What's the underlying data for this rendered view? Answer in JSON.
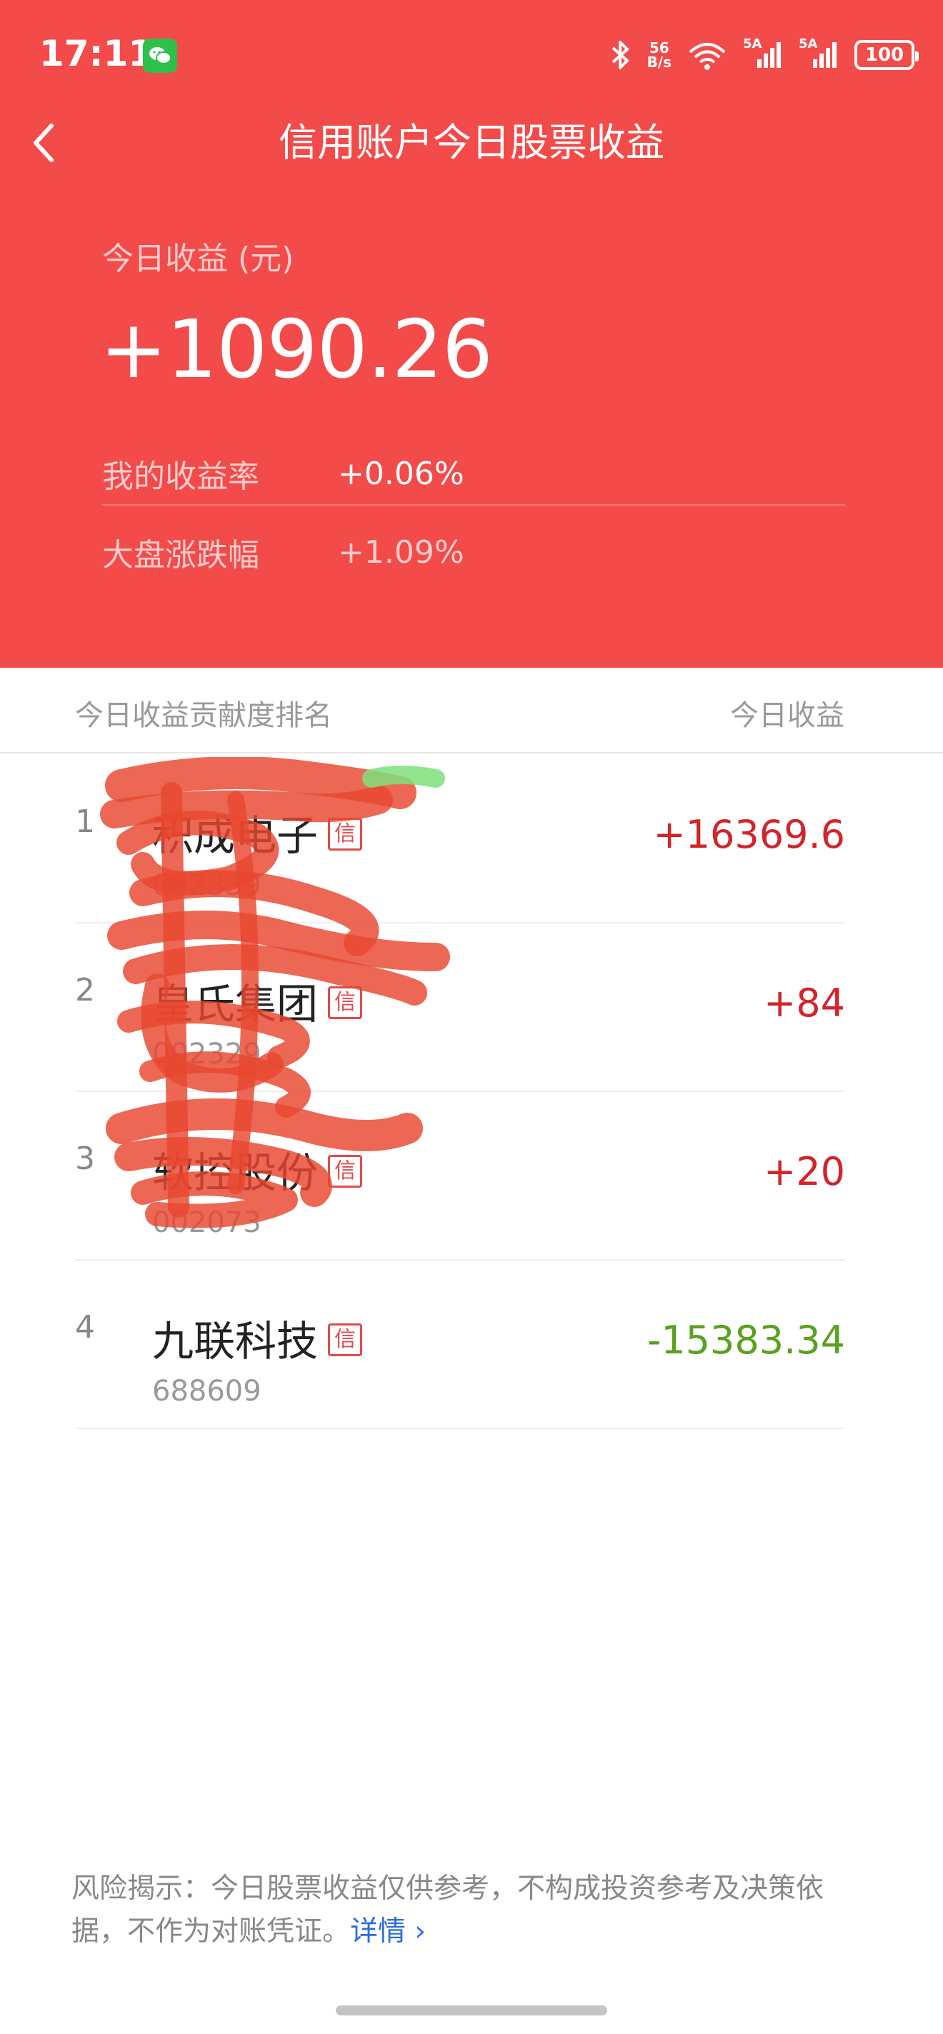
{
  "status_bar": {
    "time": "17:11",
    "network_speed_top": "56",
    "network_speed_bottom": "B/s",
    "signal1_label": "5A",
    "signal2_label": "5A",
    "battery": "100"
  },
  "nav": {
    "title": "信用账户今日股票收益"
  },
  "summary": {
    "earnings_label": "今日收益 (元)",
    "earnings_value": "+1090.26",
    "my_rate_label": "我的收益率",
    "my_rate_value": "+0.06%",
    "market_label": "大盘涨跌幅",
    "market_value": "+1.09%"
  },
  "list": {
    "header_left": "今日收益贡献度排名",
    "header_right": "今日收益",
    "items": [
      {
        "rank": "1",
        "name": "积成电子",
        "tag": "信",
        "code": "002339",
        "gain": "+16369.6",
        "direction": "up"
      },
      {
        "rank": "2",
        "name": "皇氏集团",
        "tag": "信",
        "code": "002329",
        "gain": "+84",
        "direction": "up"
      },
      {
        "rank": "3",
        "name": "软控股份",
        "tag": "信",
        "code": "002073",
        "gain": "+20",
        "direction": "up"
      },
      {
        "rank": "4",
        "name": "九联科技",
        "tag": "信",
        "code": "688609",
        "gain": "-15383.34",
        "direction": "down"
      }
    ]
  },
  "footer": {
    "disclaimer": "风险揭示：今日股票收益仅供参考，不构成投资参考及决策依据，不作为对账凭证。",
    "details_link": "详情 ›"
  },
  "colors": {
    "header_bg": "#f34a4a",
    "gain_up": "#d2242a",
    "gain_down": "#5aa11e",
    "link": "#2b6ed8"
  },
  "icons": {
    "back": "chevron-left-icon",
    "wechat": "wechat-icon",
    "bluetooth": "bluetooth-icon",
    "wifi": "wifi-icon",
    "signal": "cell-signal-icon",
    "battery": "battery-icon"
  }
}
